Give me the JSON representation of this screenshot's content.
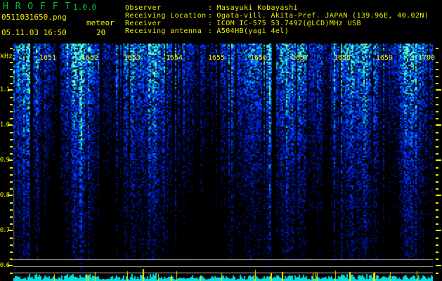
{
  "header": {
    "app_title": "H R O F F T",
    "version": "1.0.0",
    "filename": "0511031650.png",
    "mode": "meteor",
    "datetime": "05.11.03 16:50",
    "count": "20",
    "separator": ":",
    "fields": [
      {
        "label": "Observer",
        "value": "Masayuki Kobayashi"
      },
      {
        "label": "Receiving Location",
        "value": "Ogata-vill. Akita-Pref. JAPAN (139.96E, 40.02N)"
      },
      {
        "label": "Receiver",
        "value": "ICOM IC-575 53.7492(@LCD)MHz USB"
      },
      {
        "label": "Receiving antenna",
        "value": "A504HB(yagi 4el)"
      }
    ],
    "title_color": "#00c232",
    "text_color": "#f2f200"
  },
  "chart_data": {
    "type": "heatmap",
    "title": "HROFFT radio meteor echo spectrogram",
    "ylabel": "kHz",
    "y_tick_labels": [
      "1.1",
      "1.0",
      "0.9",
      "0.8",
      "0.7",
      "0.6"
    ],
    "y_range_khz": [
      0.58,
      1.23
    ],
    "x_tick_labels": [
      "1651",
      "1652",
      "1653",
      "1654",
      "1655",
      "1656",
      "1657",
      "1658",
      "1659",
      "1700"
    ],
    "x_range_time": [
      "16:51",
      "17:00"
    ],
    "grid": "horizontal lines near 0.6 kHz only",
    "gridlines_y_khz": [
      0.62,
      0.6,
      0.582
    ],
    "gridline_color": "#b2b2b2",
    "tick_color": "#f2f200",
    "noise_palette": [
      "#000c60",
      "#0018b0",
      "#0030e8",
      "#0055ff",
      "#0090e8",
      "#00c8c8",
      "#00e89a",
      "#66ffbe"
    ],
    "bottom_bar_color": "#00e0e0",
    "meteor_spike_color": "#f2f200"
  }
}
